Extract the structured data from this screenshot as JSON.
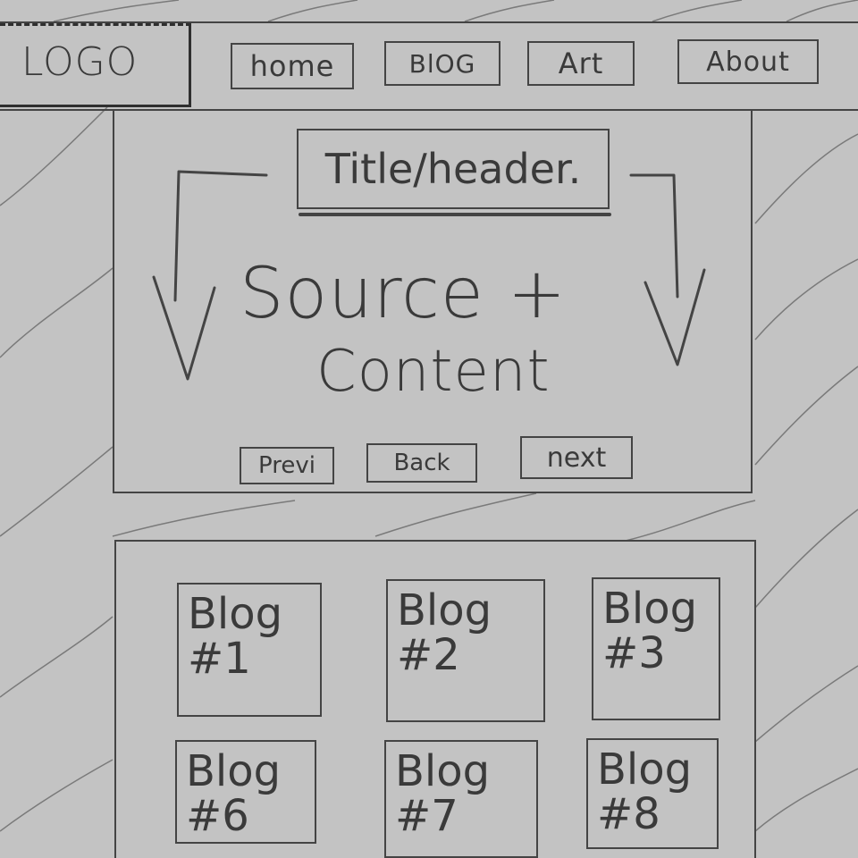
{
  "header": {
    "logo": "LOGO",
    "nav": [
      {
        "label": "home"
      },
      {
        "label": "BlOG"
      },
      {
        "label": "Art"
      },
      {
        "label": "About"
      }
    ]
  },
  "main": {
    "title": "Title/header.",
    "body_line1": "Source +",
    "body_line2": "Content",
    "pager": {
      "prev": "Previ",
      "back": "Back",
      "next": "next"
    }
  },
  "blog_grid": {
    "tiles": [
      {
        "label": "Blog",
        "number": "#1"
      },
      {
        "label": "Blog",
        "number": "#2"
      },
      {
        "label": "Blog",
        "number": "#3"
      },
      {
        "label": "Blog",
        "number": "#6"
      },
      {
        "label": "Blog",
        "number": "#7"
      },
      {
        "label": "Blog",
        "number": "#8"
      }
    ]
  },
  "colors": {
    "background": "#c3c3c3",
    "stroke": "#444444"
  }
}
